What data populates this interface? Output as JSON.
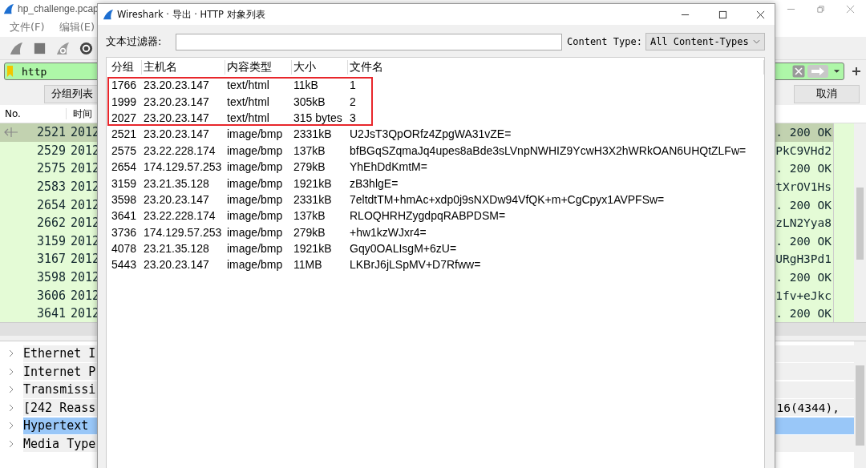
{
  "main_window": {
    "title": "hp_challenge.pcap",
    "menu": [
      "文件(F)",
      "编辑(E)"
    ],
    "display_filter": {
      "value": "http"
    },
    "packet_list_button": "分组列表",
    "cancel_button": "取消",
    "packet_list": {
      "columns": [
        "No.",
        "时间"
      ],
      "rows": [
        {
          "no": "2521",
          "time": "2012",
          "info": ". 200 OK",
          "selected": true
        },
        {
          "no": "2529",
          "time": "2012",
          "info": "PkC9VHd2",
          "selected": false
        },
        {
          "no": "2575",
          "time": "2012",
          "info": ". 200 OK",
          "selected": false
        },
        {
          "no": "2583",
          "time": "2012",
          "info": "tXrOV1Hs",
          "selected": false
        },
        {
          "no": "2654",
          "time": "2012",
          "info": ". 200 OK",
          "selected": false
        },
        {
          "no": "2662",
          "time": "2012",
          "info": "zLN2Yya8",
          "selected": false
        },
        {
          "no": "3159",
          "time": "2012",
          "info": ". 200 OK",
          "selected": false
        },
        {
          "no": "3167",
          "time": "2012",
          "info": "URgH3Pd1",
          "selected": false
        },
        {
          "no": "3598",
          "time": "2012",
          "info": ". 200 OK",
          "selected": false
        },
        {
          "no": "3606",
          "time": "2012",
          "info": "1fv+eJkc",
          "selected": false
        },
        {
          "no": "3641",
          "time": "2012",
          "info": ". 200 OK",
          "selected": false
        }
      ]
    },
    "details": [
      {
        "label": "Ethernet I",
        "selected": false
      },
      {
        "label": "Internet P",
        "selected": false
      },
      {
        "label": "Transmissi",
        "selected": false
      },
      {
        "label": "[242 Reass",
        "tail": "16(4344),",
        "selected": false
      },
      {
        "label": "Hypertext",
        "selected": true
      },
      {
        "label": "Media Type",
        "selected": false
      }
    ]
  },
  "dialog": {
    "title": "Wireshark · 导出 · HTTP 对象列表",
    "text_filter": {
      "label": "文本过滤器:"
    },
    "content_type": {
      "label": "Content Type:",
      "value": "All Content-Types"
    },
    "table": {
      "columns": [
        "分组",
        "主机名",
        "内容类型",
        "大小",
        "文件名"
      ],
      "rows": [
        {
          "cells": [
            "1766",
            "23.20.23.147",
            "text/html",
            "11kB",
            "1"
          ],
          "highlighted": true
        },
        {
          "cells": [
            "1999",
            "23.20.23.147",
            "text/html",
            "305kB",
            "2"
          ],
          "highlighted": true
        },
        {
          "cells": [
            "2027",
            "23.20.23.147",
            "text/html",
            "315 bytes",
            "3"
          ],
          "highlighted": true
        },
        {
          "cells": [
            "2521",
            "23.20.23.147",
            "image/bmp",
            "2331kB",
            "U2JsT3QpORfz4ZpgWA31vZE="
          ],
          "highlighted": false
        },
        {
          "cells": [
            "2575",
            "23.22.228.174",
            "image/bmp",
            "137kB",
            "bfBGqSZqmaJq4upes8aBde3sLVnpNWHIZ9YcwH3X2hWRkOAN6UHQtZLFw="
          ],
          "highlighted": false
        },
        {
          "cells": [
            "2654",
            "174.129.57.253",
            "image/bmp",
            "279kB",
            "YhEhDdKmtM="
          ],
          "highlighted": false
        },
        {
          "cells": [
            "3159",
            "23.21.35.128",
            "image/bmp",
            "1921kB",
            "zB3hlgE="
          ],
          "highlighted": false
        },
        {
          "cells": [
            "3598",
            "23.20.23.147",
            "image/bmp",
            "2331kB",
            "7eltdtTM+hmAc+xdp0j9sNXDw94VfQK+m+CgCpyx1AVPFSw="
          ],
          "highlighted": false
        },
        {
          "cells": [
            "3641",
            "23.22.228.174",
            "image/bmp",
            "137kB",
            "RLOQHRHZygdpqRABPDSM="
          ],
          "highlighted": false
        },
        {
          "cells": [
            "3736",
            "174.129.57.253",
            "image/bmp",
            "279kB",
            "+hw1kzWJxr4="
          ],
          "highlighted": false
        },
        {
          "cells": [
            "4078",
            "23.21.35.128",
            "image/bmp",
            "1921kB",
            "Gqy0OALIsgM+6zU="
          ],
          "highlighted": false
        },
        {
          "cells": [
            "5443",
            "23.20.23.147",
            "image/bmp",
            "11MB",
            "LKBrJ6jLSpMV+D7Rfww="
          ],
          "highlighted": false
        }
      ]
    }
  }
}
